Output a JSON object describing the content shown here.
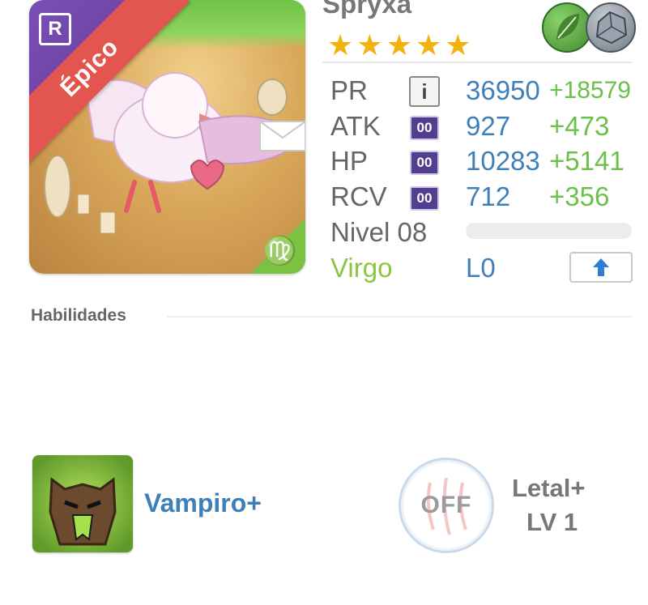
{
  "card": {
    "rarity": "Épico",
    "rank": "R",
    "zodiac_symbol": "♍"
  },
  "unit": {
    "name": "Spryxa",
    "stars": 5,
    "elements": [
      "leaf-element-icon",
      "rock-element-icon"
    ]
  },
  "stats": {
    "pr": {
      "label": "PR",
      "value": "36950",
      "bonus": "+18579"
    },
    "atk": {
      "label": "ATK",
      "chip": "00",
      "value": "927",
      "bonus": "+473"
    },
    "hp": {
      "label": "HP",
      "chip": "00",
      "value": "10283",
      "bonus": "+5141"
    },
    "rcv": {
      "label": "RCV",
      "chip": "00",
      "value": "712",
      "bonus": "+356"
    }
  },
  "level": {
    "label": "Nivel 08",
    "progress": 0.0
  },
  "sign": {
    "name": "Virgo",
    "limit": "L0"
  },
  "skills": {
    "heading": "Habilidades",
    "active": {
      "name": "Vampiro+"
    },
    "passive": {
      "state": "OFF",
      "name": "Letal+",
      "level": "LV 1"
    }
  },
  "colors": {
    "accent_blue": "#3f7fb9",
    "bonus_green": "#6cc04a",
    "virgo_green": "#8cc63f",
    "rarity_red": "#e3554f",
    "star_gold": "#f4b20f"
  }
}
